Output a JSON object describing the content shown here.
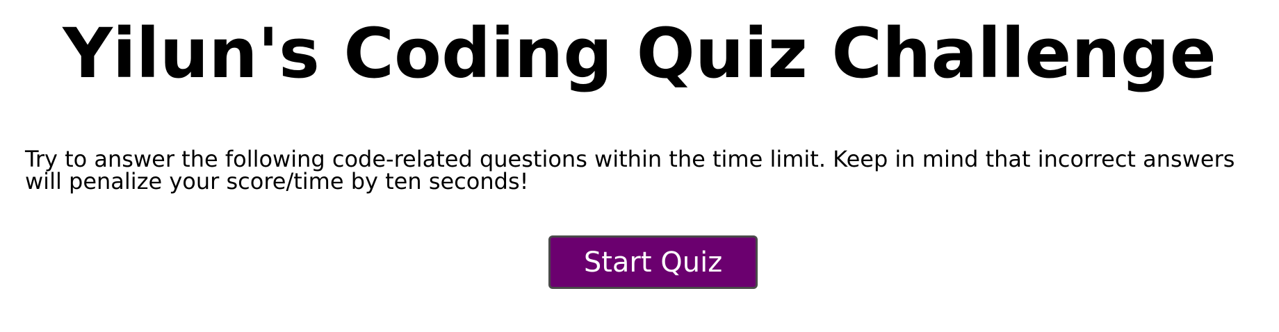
{
  "header": {
    "title": "Yilun's Coding Quiz Challenge"
  },
  "intro": {
    "text": "Try to answer the following code-related questions within the time limit. Keep in mind that incorrect answers will penalize your score/time by ten seconds!"
  },
  "actions": {
    "start_label": "Start Quiz",
    "button_color": "#6b006f"
  }
}
